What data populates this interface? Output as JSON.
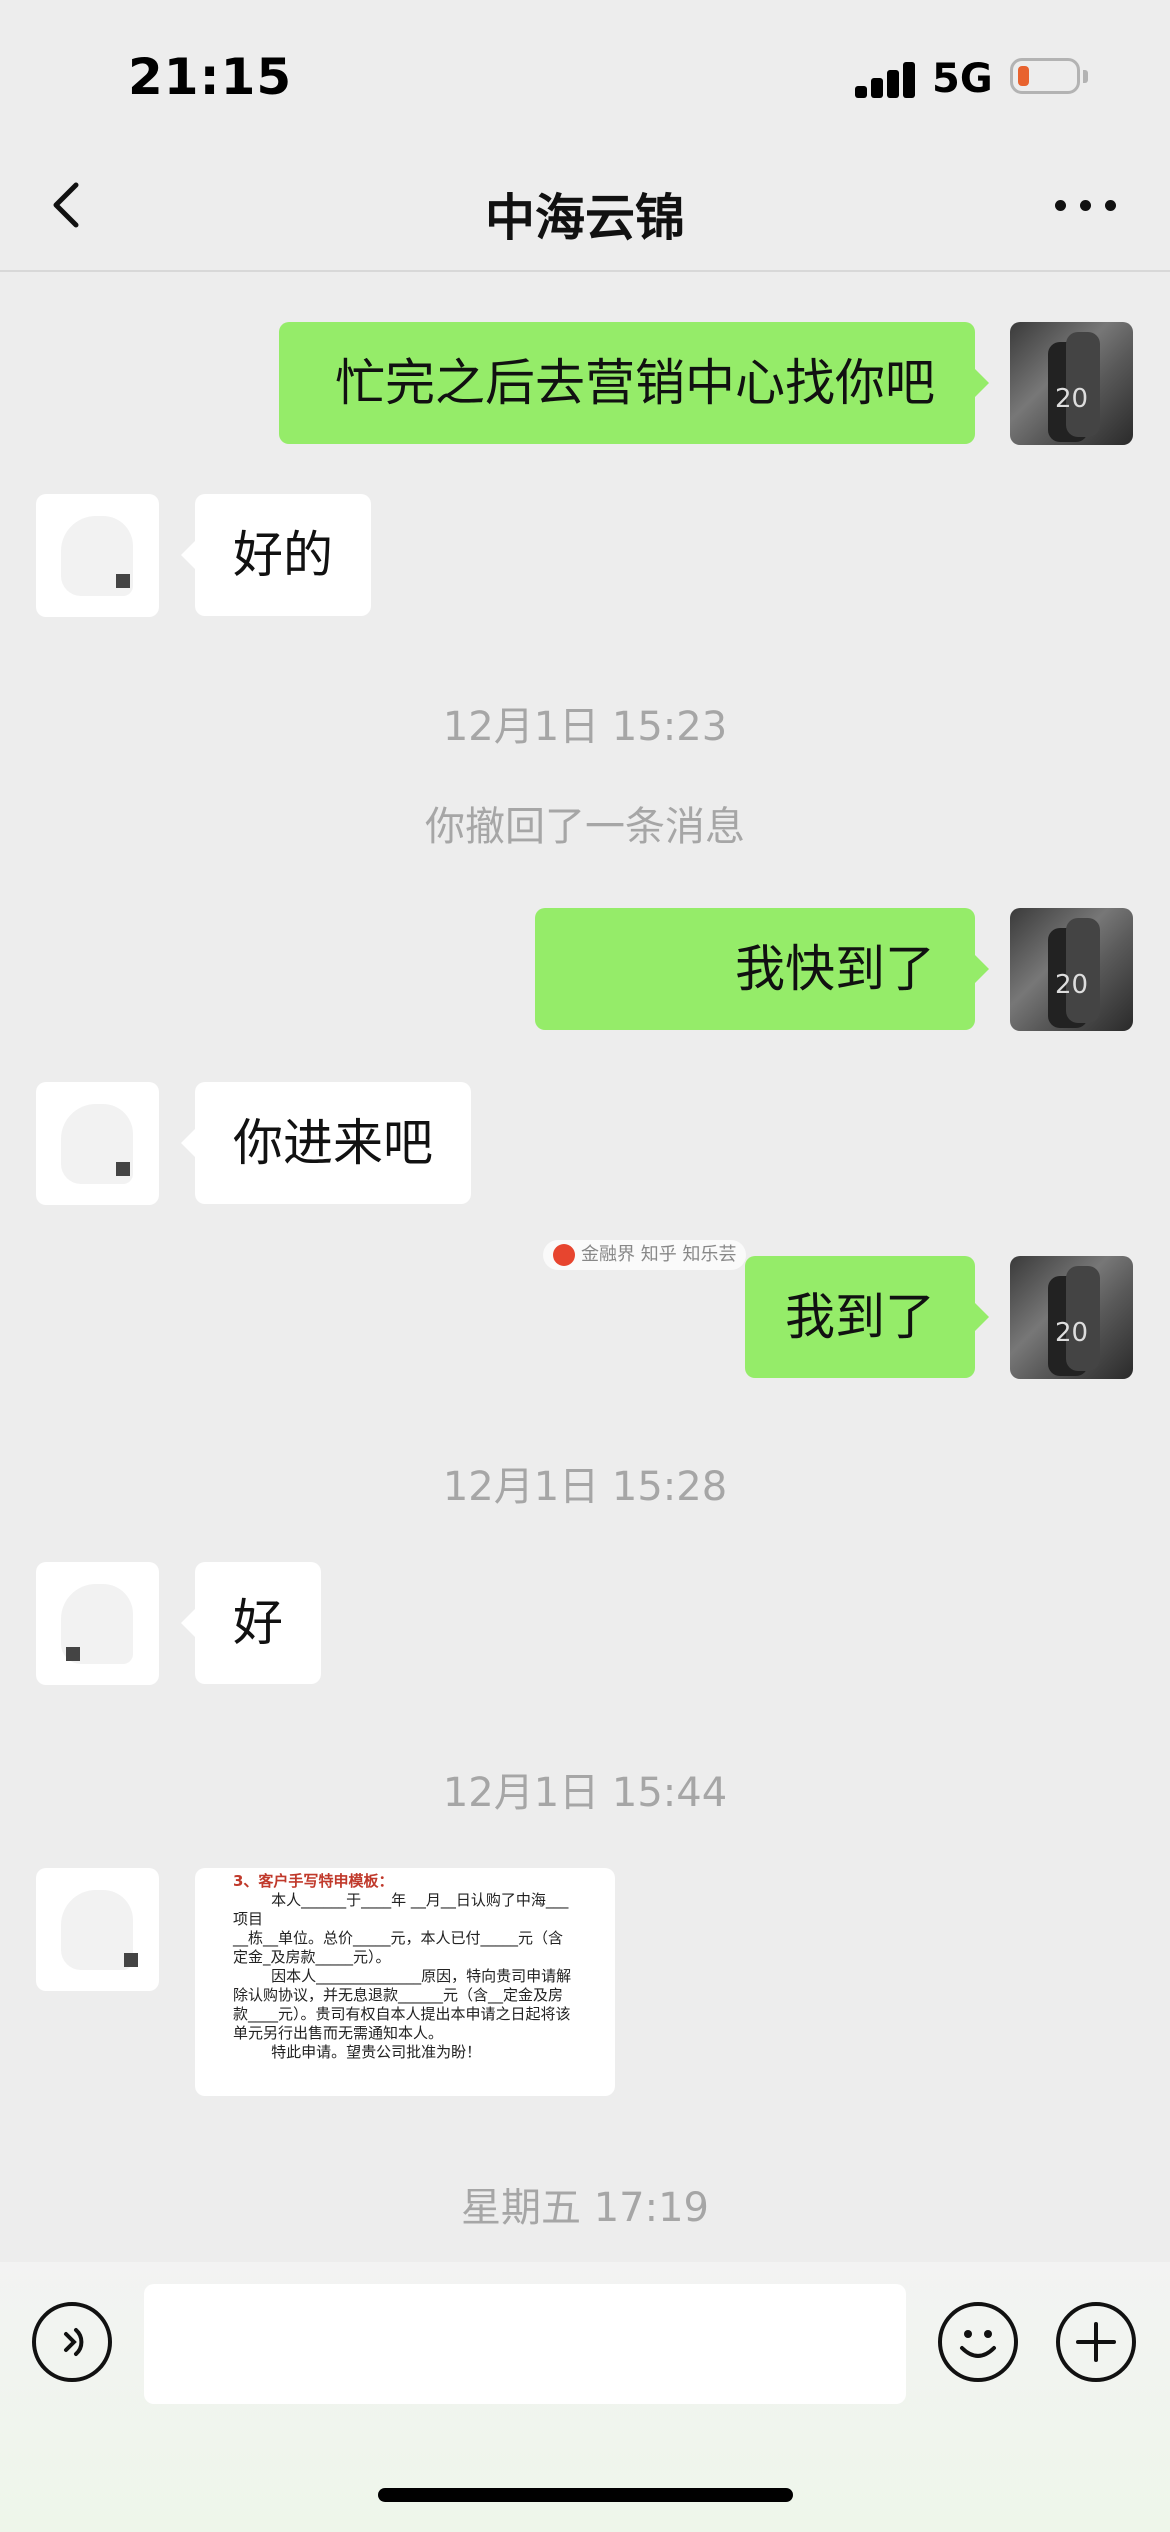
{
  "status_bar": {
    "time": "21:15",
    "network": "5G",
    "icons": [
      "signal-icon",
      "battery-icon"
    ]
  },
  "header": {
    "title": "中海云锦",
    "icons": [
      "back-icon",
      "more-icon"
    ]
  },
  "messages": [
    {
      "side": "self",
      "text": "忙完之后去营销中心找你吧"
    },
    {
      "side": "other",
      "text": "好的"
    },
    {
      "type": "time",
      "text": "12月1日 15:23"
    },
    {
      "type": "system",
      "text": "你撤回了一条消息"
    },
    {
      "side": "self",
      "text": "我快到了"
    },
    {
      "side": "other",
      "text": "你进来吧"
    },
    {
      "side": "self",
      "text": "我到了"
    },
    {
      "type": "time",
      "text": "12月1日 15:28"
    },
    {
      "side": "other",
      "text": "好"
    },
    {
      "type": "time",
      "text": "12月1日 15:44"
    },
    {
      "side": "other",
      "type": "image",
      "image": {
        "heading": "3、客户手写特申模板：",
        "body": "        本人______于____年 __月__日认购了中海___项目\n__栋__单位。总价_____元，本人已付_____元（含定金_及房款_____元）。\n        因本人______________原因，特向贵司申请解除认购协议，并无息退款______元（含__定金及房款____元）。贵司有权自本人提出本申请之日起将该单元另行出售而无需通知本人。\n        特此申请。望贵公司批准为盼！"
      }
    },
    {
      "type": "time",
      "text": "星期五 17:19"
    }
  ],
  "watermark": "金融界 知乎 知乐芸",
  "input_bar": {
    "placeholder": "",
    "icons": [
      "voice-icon",
      "emoji-icon",
      "plus-icon"
    ]
  },
  "colors": {
    "self_bubble": "#95ec69",
    "other_bubble": "#ffffff",
    "background": "#ededed"
  }
}
